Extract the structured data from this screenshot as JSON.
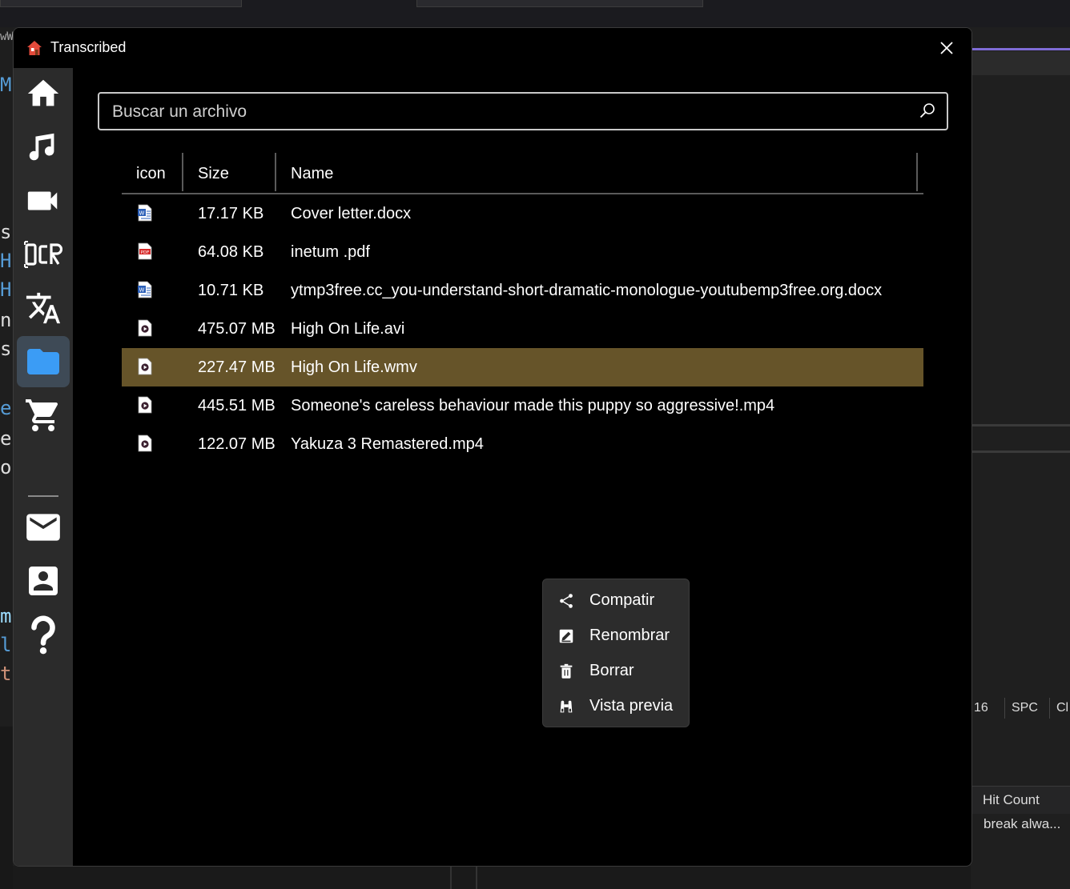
{
  "window": {
    "title": "Transcribed",
    "close_label": "close"
  },
  "sidebar": {
    "items": [
      {
        "name": "home",
        "icon": "home-icon"
      },
      {
        "name": "music",
        "icon": "music-note-icon"
      },
      {
        "name": "video",
        "icon": "video-camera-icon"
      },
      {
        "name": "ocr",
        "icon": "ocr-icon",
        "label": "OCR"
      },
      {
        "name": "translate",
        "icon": "translate-icon"
      },
      {
        "name": "files",
        "icon": "folder-icon",
        "active": true
      },
      {
        "name": "store",
        "icon": "shopping-cart-icon"
      },
      {
        "name": "mail",
        "icon": "mail-icon"
      },
      {
        "name": "contact",
        "icon": "contact-icon"
      },
      {
        "name": "help",
        "icon": "help-icon",
        "label": "?"
      }
    ]
  },
  "search": {
    "placeholder": "Buscar un archivo",
    "value": ""
  },
  "table": {
    "columns": [
      "icon",
      "Size",
      "Name"
    ],
    "rows": [
      {
        "icon": "word-file-icon",
        "size": "17.17 KB",
        "name": "Cover letter.docx"
      },
      {
        "icon": "pdf-file-icon",
        "size": "64.08 KB",
        "name": "inetum .pdf"
      },
      {
        "icon": "word-file-icon",
        "size": "10.71 KB",
        "name": "ytmp3free.cc_you-understand-short-dramatic-monologue-youtubemp3free.org.docx"
      },
      {
        "icon": "video-file-icon",
        "size": "475.07 MB",
        "name": "High On Life.avi"
      },
      {
        "icon": "video-file-icon",
        "size": "227.47 MB",
        "name": "High On Life.wmv",
        "selected": true
      },
      {
        "icon": "video-file-icon",
        "size": "445.51 MB",
        "name": "Someone's careless behaviour made this puppy so aggressive!.mp4"
      },
      {
        "icon": "video-file-icon",
        "size": "122.07 MB",
        "name": "Yakuza 3 Remastered.mp4"
      }
    ]
  },
  "context_menu": {
    "items": [
      {
        "label": "Compatir",
        "icon": "share-icon"
      },
      {
        "label": "Renombrar",
        "icon": "rename-icon"
      },
      {
        "label": "Borrar",
        "icon": "trash-icon"
      },
      {
        "label": "Vista previa",
        "icon": "binoculars-icon"
      }
    ]
  },
  "background": {
    "code_chars": [
      "M",
      "s",
      "H",
      "H",
      "n",
      "s",
      "e",
      "e",
      "o",
      "m",
      "l",
      "t"
    ],
    "status": [
      "16",
      "SPC",
      "Cl"
    ],
    "panel_header": "Hit Count",
    "panel_cell": "break alwa...",
    "code_prefix": "wW"
  },
  "colors": {
    "selected_row": "#665429",
    "active_nav": "#3e4a56",
    "folder": "#3b9cf5",
    "accent": "#7f6cd6"
  }
}
